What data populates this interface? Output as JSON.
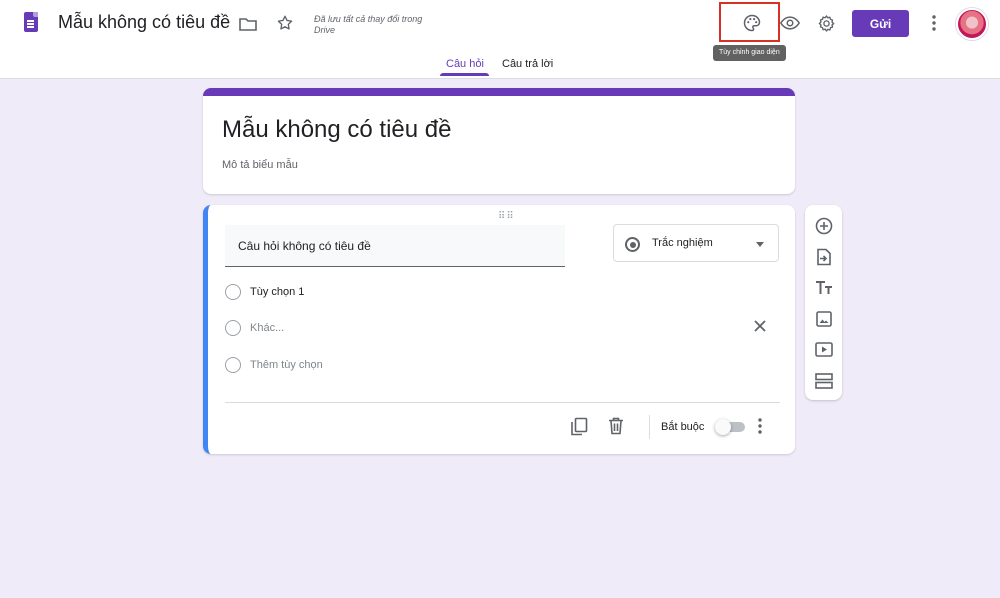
{
  "header": {
    "doc_title": "Mẫu không có tiêu đề",
    "saved_note": "Đã lưu tất cả thay đổi trong Drive",
    "tooltip": "Tùy chỉnh giao diện",
    "send_label": "Gửi"
  },
  "tabs": [
    {
      "label": "Câu hỏi",
      "active": true
    },
    {
      "label": "Câu trả lời",
      "active": false
    }
  ],
  "form": {
    "title": "Mẫu không có tiêu đề",
    "description": "Mô tả biểu mẫu"
  },
  "question": {
    "text": "Câu hỏi không có tiêu đề",
    "type": "Trắc nghiệm",
    "options": [
      {
        "label": "Tùy chọn 1",
        "muted": false
      },
      {
        "label": "Khác...",
        "muted": true
      },
      {
        "label": "Thêm tùy chọn",
        "muted": true
      }
    ],
    "required_label": "Bắt buộc",
    "required": false
  },
  "icons": {
    "doc": "forms-doc-icon",
    "folder": "folder-icon",
    "star": "star-icon",
    "palette": "palette-icon",
    "preview": "eye-icon",
    "settings": "gear-icon",
    "more": "more-vert-icon",
    "close": "close-icon",
    "duplicate": "copy-icon",
    "delete": "trash-icon",
    "side_toolbar": [
      "add-question-icon",
      "import-questions-icon",
      "add-title-icon",
      "add-image-icon",
      "add-video-icon",
      "add-section-icon"
    ]
  },
  "colors": {
    "accent": "#673ab7",
    "background": "#f0ebf8",
    "question_focus": "#4285f4",
    "highlight": "#d93025"
  }
}
